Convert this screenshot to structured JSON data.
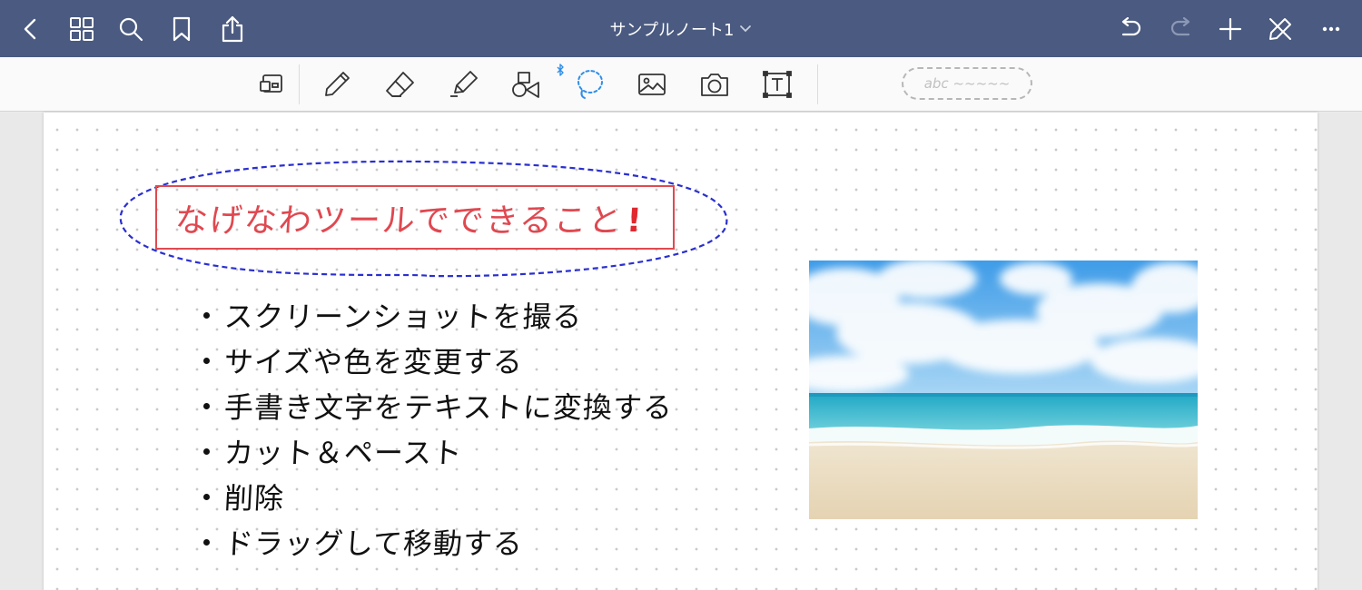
{
  "topbar": {
    "title": "サンプルノート1",
    "icons": [
      "back-chevron-icon",
      "grid-thumbnails-icon",
      "search-icon",
      "bookmark-icon",
      "share-icon",
      "undo-icon",
      "redo-icon",
      "add-icon",
      "pen-off-icon",
      "more-icon"
    ],
    "redo_enabled": false
  },
  "toolbar": {
    "tools": [
      "zoom-window-icon",
      "pen-icon",
      "eraser-icon",
      "highlighter-icon",
      "shapes-icon",
      "lasso-icon",
      "image-icon",
      "camera-icon",
      "text-icon"
    ],
    "selected_tool": "lasso-icon",
    "bluetooth_indicator": "bluetooth-icon",
    "handwriting_placeholder": "abc ~~~~~"
  },
  "note": {
    "heading": "なげなわツールでできること",
    "heading_mark": "!",
    "bullets": [
      "スクリーンショットを撮る",
      "サイズや色を変更する",
      "手書き文字をテキストに変換する",
      "カット＆ペースト",
      "削除",
      "ドラッグして移動する"
    ],
    "image_subject": "beach-photo"
  },
  "colors": {
    "nav_bar": "#4a5a80",
    "heading_red": "#e04850",
    "lasso_blue": "#2a2fd0",
    "accent_blue": "#2f8fe8"
  }
}
